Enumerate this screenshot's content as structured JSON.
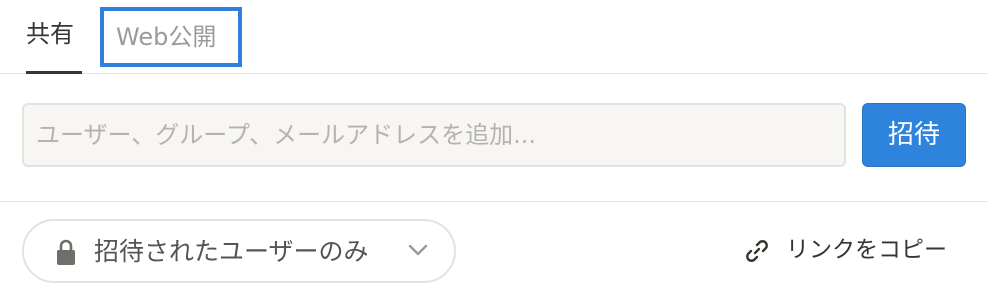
{
  "tabs": {
    "share": "共有",
    "publish": "Web公開"
  },
  "invite": {
    "placeholder": "ユーザー、グループ、メールアドレスを追加...",
    "value": "",
    "button_label": "招待"
  },
  "access": {
    "label": "招待されたユーザーのみ",
    "icon": "lock-icon"
  },
  "copy_link": {
    "label": "リンクをコピー",
    "icon": "link-icon"
  },
  "colors": {
    "accent": "#2e83dd",
    "highlight_border": "#2f7fe0",
    "text": "#37352f",
    "muted_text": "#9b9a97"
  }
}
